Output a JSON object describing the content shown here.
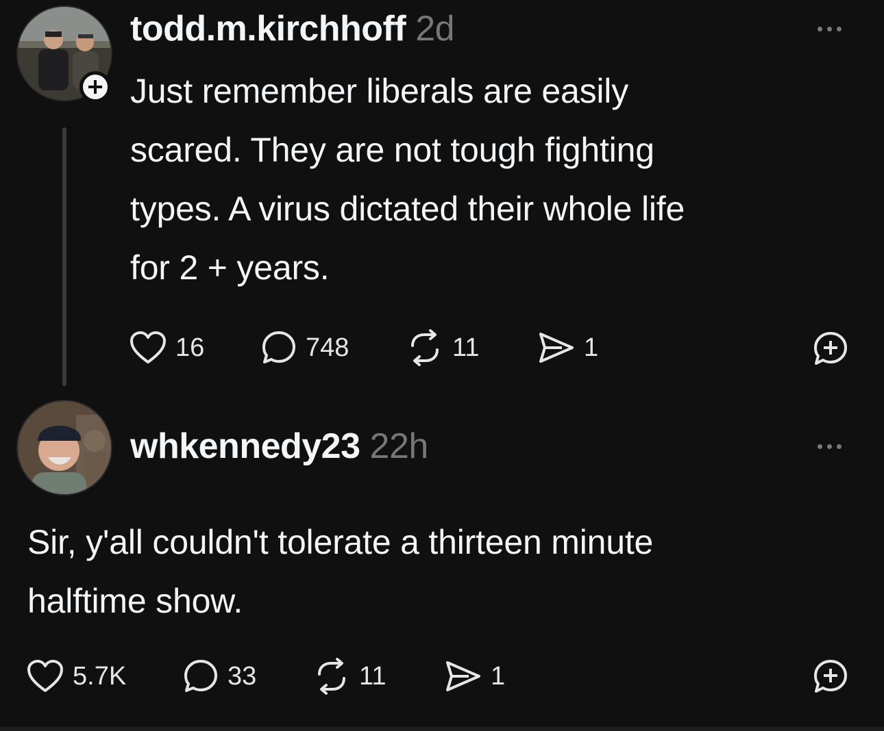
{
  "posts": [
    {
      "username": "todd.m.kirchhoff",
      "timestamp": "2d",
      "text": "Just remember liberals are easily\nscared. They are not tough fighting\ntypes. A virus dictated their whole life\nfor 2 + years.",
      "likes": "16",
      "replies": "748",
      "reposts": "11",
      "shares": "1",
      "avatar_icon": "profile-photo",
      "follow_icon": "plus-icon"
    },
    {
      "username": "whkennedy23",
      "timestamp": "22h",
      "text": "Sir, y'all couldn't tolerate a thirteen minute\nhalftime show.",
      "likes": "5.7K",
      "replies": "33",
      "reposts": "11",
      "shares": "1",
      "avatar_icon": "profile-photo"
    }
  ],
  "icons": {
    "like": "heart-icon",
    "reply": "comment-icon",
    "repost": "repost-icon",
    "share": "send-icon",
    "quote": "quote-plus-icon",
    "more": "more-dots-icon"
  },
  "colors": {
    "background": "#101010",
    "text": "#f3f5f7",
    "muted": "#777777",
    "thread_line": "#3a3a3a"
  }
}
